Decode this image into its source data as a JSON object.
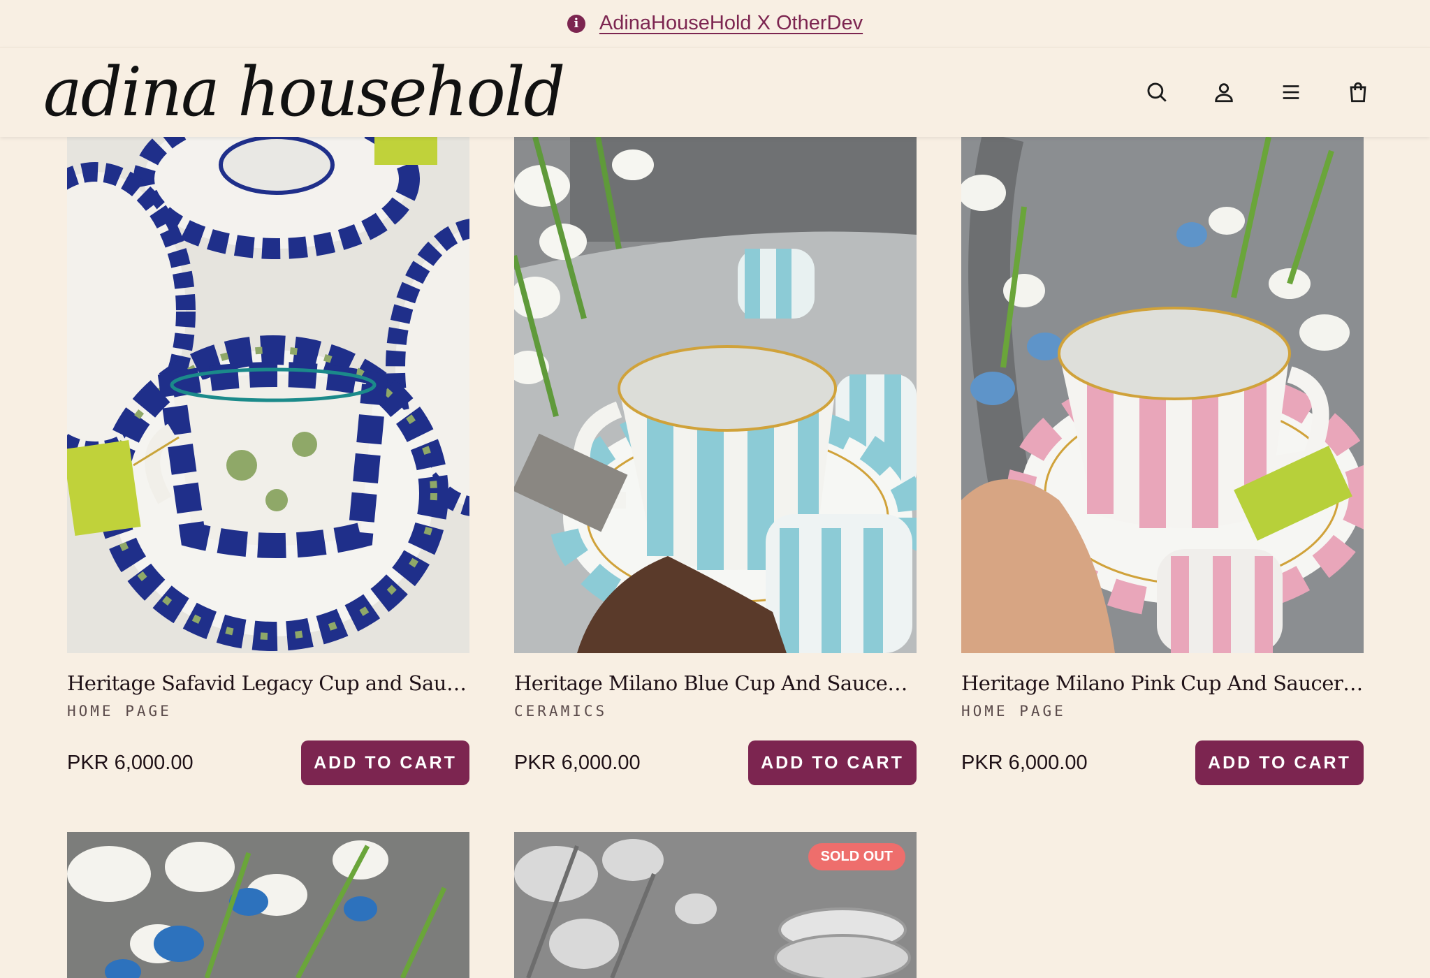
{
  "announcement": {
    "text": "AdinaHouseHold X OtherDev"
  },
  "header": {
    "logo": "adina household",
    "icons": [
      "search-icon",
      "account-icon",
      "menu-icon",
      "cart-icon"
    ]
  },
  "products": [
    {
      "title": "Heritage Safavid Legacy Cup and Saucer S...",
      "vendor": "HOME PAGE",
      "price": "PKR 6,000.00",
      "button": "ADD TO CART"
    },
    {
      "title": "Heritage Milano Blue Cup And Saucer Set ...",
      "vendor": "CERAMICS",
      "price": "PKR 6,000.00",
      "button": "ADD TO CART"
    },
    {
      "title": "Heritage Milano Pink Cup And Saucer Set ...",
      "vendor": "HOME PAGE",
      "price": "PKR 6,000.00",
      "button": "ADD TO CART"
    },
    {
      "badge": ""
    },
    {
      "badge": "SOLD OUT"
    }
  ],
  "colors": {
    "background": "#f8efe3",
    "accent": "#7c2550",
    "sold_out": "#ee6e6c"
  }
}
